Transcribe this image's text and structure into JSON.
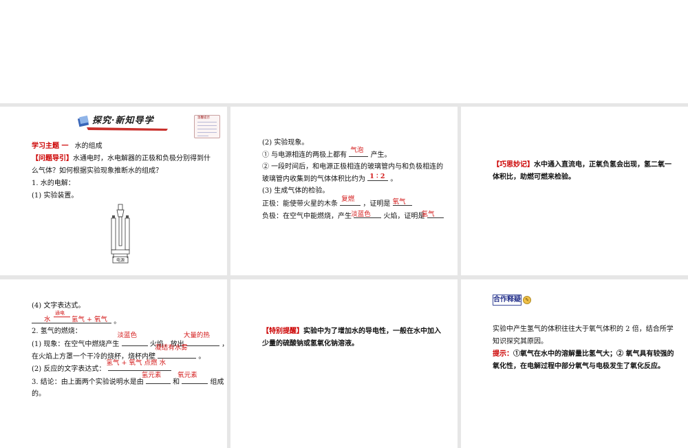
{
  "slide1": {
    "banner_title": "探究·新知导学",
    "note_title": "温馨提示",
    "topic_label": "学习主题 一",
    "topic_title": "水的组成",
    "question_label": "【问题导引】",
    "question_text_1": "水通电时，水电解器的正极和负极分别得到什",
    "question_text_2": "么气体？如何根据实验现象推断水的组成？",
    "item1": "1. 水的电解：",
    "item1_1": "(1) 实验装置。",
    "apparatus_label": "电源"
  },
  "slide2": {
    "item2": "(2) 实验现象。",
    "line1_pre": "① 与电源相连的两极上都有",
    "line1_ans": "气泡",
    "line1_post": "产生。",
    "line2_1": "② 一段时间后，和电源正极相连的玻璃管内与和负极相连的",
    "line2_2_pre": "玻璃管内收集到的气体体积比约为",
    "line2_ans": "1 ∶ 2",
    "line2_post": "。",
    "item3": "(3) 生成气体的检验。",
    "pos_pre": "正极：能使带火星的木条",
    "pos_ans1": "复燃",
    "pos_mid": "，证明是",
    "pos_ans2": "氧气",
    "neg_pre": "负极：在空气中能燃烧，产生",
    "neg_ans1": "淡蓝色",
    "neg_mid": "火焰，证明是",
    "neg_ans2": "氢气"
  },
  "slide3": {
    "label": "【巧思妙记】",
    "text_1": "水中通入直流电，正氧负氢会出现，氢二氧一",
    "text_2": "体积比，助燃可燃来检验。"
  },
  "slide4": {
    "item4": "(4) 文字表达式。",
    "eq_left": "水",
    "eq_condition": "通电",
    "eq_right": "氢气 + 氧气",
    "eq_end": "。",
    "item_b": "2. 氢气的燃烧：",
    "phen_pre": "(1) 现象：在空气中燃烧产生",
    "phen_ans1": "淡蓝色",
    "phen_mid": "火焰，放出",
    "phen_ans2": "大量的热",
    "phen_end": "，",
    "phen2_pre": "在火焰上方罩一个干冷的烧杯，烧杯内壁",
    "phen2_ans": "凝结有水雾",
    "phen2_end": "。",
    "react_pre": "(2) 反应的文字表达式：",
    "react_ans": "氢气 + 氧气 点燃 水",
    "concl_pre": "3. 结论：由上面两个实验说明水是由",
    "concl_ans1": "氢元素",
    "concl_mid": "和",
    "concl_ans2": "氧元素",
    "concl_post": "组成",
    "concl_end": "的。"
  },
  "slide5": {
    "label": "【特别提醒】",
    "text_1": "实验中为了增加水的导电性，一般在水中加入",
    "text_2": "少量的硫酸钠或氢氧化钠溶液。"
  },
  "slide6": {
    "tag": "合作释疑",
    "text_1": "实验中产生氢气的体积往往大于氧气体积的 2 倍，结合所学",
    "text_2": "知识探究其原因。",
    "hint_label": "提示：",
    "hint_1": "①氧气在水中的溶解量比氢气大；② 氧气具有较强的",
    "hint_2": "氧化性，在电解过程中部分氧气与电极发生了氧化反应。"
  },
  "colors": {
    "answer": "#d31a1a",
    "label": "#cc0000",
    "tag_border": "#3b4a9a"
  }
}
